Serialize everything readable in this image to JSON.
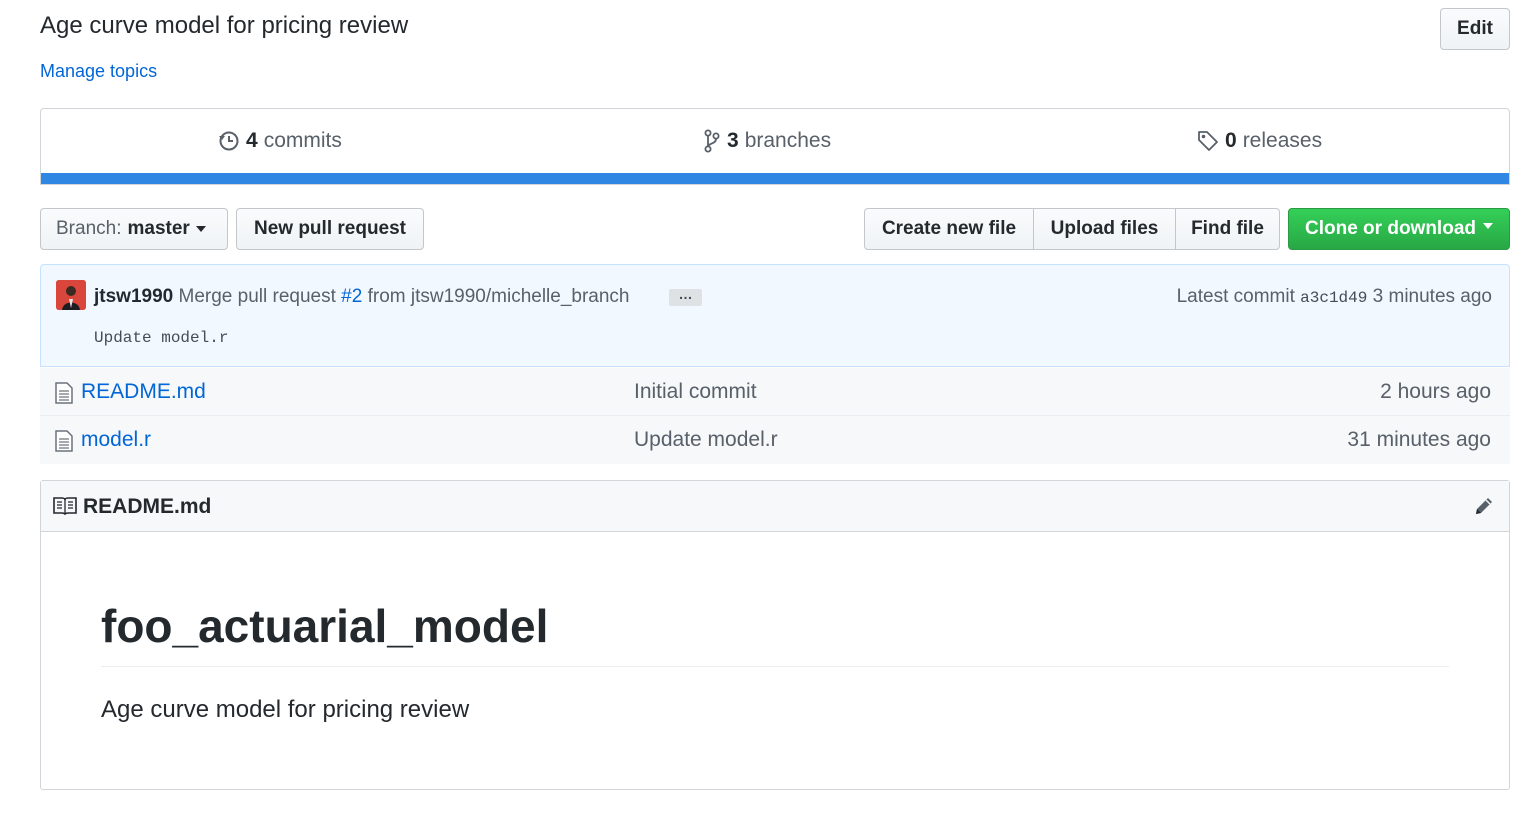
{
  "repo": {
    "description": "Age curve model for pricing review",
    "manage_topics": "Manage topics",
    "edit_label": "Edit"
  },
  "summary": {
    "commits_count": "4",
    "commits_label": "commits",
    "branches_count": "3",
    "branches_label": "branches",
    "releases_count": "0",
    "releases_label": "releases",
    "language_bar_color": "#2f87e3"
  },
  "toolbar": {
    "branch_prefix": "Branch:",
    "branch_name": "master",
    "new_pull_request": "New pull request",
    "create_new_file": "Create new file",
    "upload_files": "Upload files",
    "find_file": "Find file",
    "clone_or_download": "Clone or download"
  },
  "latest_commit": {
    "author": "jtsw1990",
    "message_prefix": "Merge pull request",
    "pr_link": "#2",
    "message_suffix": "from jtsw1990/michelle_branch",
    "ellipsis": "…",
    "latest_label": "Latest commit",
    "sha": "a3c1d49",
    "time": "3 minutes ago",
    "description": "Update model.r"
  },
  "files": [
    {
      "icon": "file-icon",
      "name": "README.md",
      "message": "Initial commit",
      "age": "2 hours ago"
    },
    {
      "icon": "file-icon",
      "name": "model.r",
      "message": "Update model.r",
      "age": "31 minutes ago"
    }
  ],
  "readme": {
    "header_title": "README.md",
    "heading": "foo_actuarial_model",
    "body": "Age curve model for pricing review"
  },
  "colors": {
    "link": "#0366d6",
    "green_button": "#28a745",
    "commit_bg": "#f1f8ff",
    "commit_border": "#c8e1ff"
  }
}
